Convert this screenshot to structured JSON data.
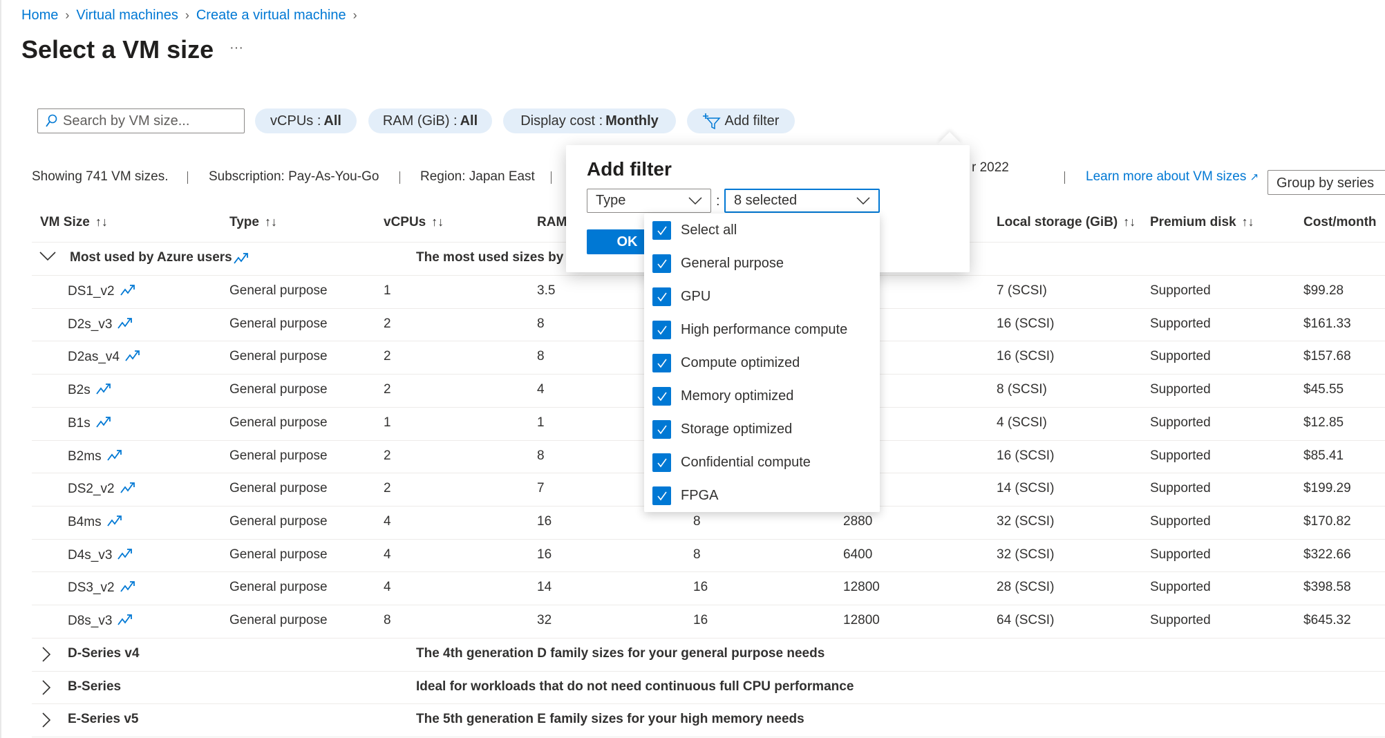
{
  "breadcrumb": [
    {
      "label": "Home"
    },
    {
      "label": "Virtual machines"
    },
    {
      "label": "Create a virtual machine"
    }
  ],
  "page": {
    "title": "Select a VM size",
    "more": "···"
  },
  "filters": {
    "search_placeholder": "Search by VM size...",
    "vcpus": {
      "label": "vCPUs : ",
      "value": "All"
    },
    "ram": {
      "label": "RAM (GiB) : ",
      "value": "All"
    },
    "cost": {
      "label": "Display cost : ",
      "value": "Monthly"
    },
    "add_filter": "Add filter"
  },
  "info": {
    "showing": "Showing 741 VM sizes.",
    "subscription": "Subscription: Pay-As-You-Go",
    "region": "Region: Japan East",
    "date_fragment": "r 2022",
    "learn_more": "Learn more about VM sizes",
    "group_by": "Group by series"
  },
  "columns": {
    "vm_size": "VM Size",
    "type": "Type",
    "vcpus": "vCPUs",
    "ram": "RAM",
    "local_storage": "Local storage (GiB)",
    "premium_disk": "Premium disk",
    "cost": "Cost/month",
    "sort": "↑↓"
  },
  "group": {
    "name": "Most used by Azure users",
    "description": "The most used sizes by u"
  },
  "rows": [
    {
      "name": "DS1_v2",
      "type": "General purpose",
      "vcpus": "1",
      "ram": "3.5",
      "data_disks": "",
      "iops": "",
      "storage": "7 (SCSI)",
      "premium": "Supported",
      "cost": "$99.28"
    },
    {
      "name": "D2s_v3",
      "type": "General purpose",
      "vcpus": "2",
      "ram": "8",
      "data_disks": "",
      "iops": "",
      "storage": "16 (SCSI)",
      "premium": "Supported",
      "cost": "$161.33"
    },
    {
      "name": "D2as_v4",
      "type": "General purpose",
      "vcpus": "2",
      "ram": "8",
      "data_disks": "",
      "iops": "",
      "storage": "16 (SCSI)",
      "premium": "Supported",
      "cost": "$157.68"
    },
    {
      "name": "B2s",
      "type": "General purpose",
      "vcpus": "2",
      "ram": "4",
      "data_disks": "",
      "iops": "",
      "storage": "8 (SCSI)",
      "premium": "Supported",
      "cost": "$45.55"
    },
    {
      "name": "B1s",
      "type": "General purpose",
      "vcpus": "1",
      "ram": "1",
      "data_disks": "",
      "iops": "",
      "storage": "4 (SCSI)",
      "premium": "Supported",
      "cost": "$12.85"
    },
    {
      "name": "B2ms",
      "type": "General purpose",
      "vcpus": "2",
      "ram": "8",
      "data_disks": "",
      "iops": "",
      "storage": "16 (SCSI)",
      "premium": "Supported",
      "cost": "$85.41"
    },
    {
      "name": "DS2_v2",
      "type": "General purpose",
      "vcpus": "2",
      "ram": "7",
      "data_disks": "",
      "iops": "",
      "storage": "14 (SCSI)",
      "premium": "Supported",
      "cost": "$199.29"
    },
    {
      "name": "B4ms",
      "type": "General purpose",
      "vcpus": "4",
      "ram": "16",
      "data_disks": "8",
      "iops": "2880",
      "storage": "32 (SCSI)",
      "premium": "Supported",
      "cost": "$170.82"
    },
    {
      "name": "D4s_v3",
      "type": "General purpose",
      "vcpus": "4",
      "ram": "16",
      "data_disks": "8",
      "iops": "6400",
      "storage": "32 (SCSI)",
      "premium": "Supported",
      "cost": "$322.66"
    },
    {
      "name": "DS3_v2",
      "type": "General purpose",
      "vcpus": "4",
      "ram": "14",
      "data_disks": "16",
      "iops": "12800",
      "storage": "28 (SCSI)",
      "premium": "Supported",
      "cost": "$398.58"
    },
    {
      "name": "D8s_v3",
      "type": "General purpose",
      "vcpus": "8",
      "ram": "32",
      "data_disks": "16",
      "iops": "12800",
      "storage": "64 (SCSI)",
      "premium": "Supported",
      "cost": "$645.32"
    }
  ],
  "series": [
    {
      "name": "D-Series v4",
      "description": "The 4th generation D family sizes for your general purpose needs"
    },
    {
      "name": "B-Series",
      "description": "Ideal for workloads that do not need continuous full CPU performance"
    },
    {
      "name": "E-Series v5",
      "description": "The 5th generation E family sizes for your high memory needs"
    }
  ],
  "add_filter_popup": {
    "title": "Add filter",
    "field": "Type",
    "colon": ":",
    "value": "8 selected",
    "ok": "OK",
    "options": [
      {
        "label": "Select all",
        "checked": true
      },
      {
        "label": "General purpose",
        "checked": true
      },
      {
        "label": "GPU",
        "checked": true
      },
      {
        "label": "High performance compute",
        "checked": true
      },
      {
        "label": "Compute optimized",
        "checked": true
      },
      {
        "label": "Memory optimized",
        "checked": true
      },
      {
        "label": "Storage optimized",
        "checked": true
      },
      {
        "label": "Confidential compute",
        "checked": true
      },
      {
        "label": "FPGA",
        "checked": true
      }
    ]
  },
  "colors": {
    "accent": "#0078d4",
    "text": "#323130",
    "pill": "#e3eef9"
  }
}
